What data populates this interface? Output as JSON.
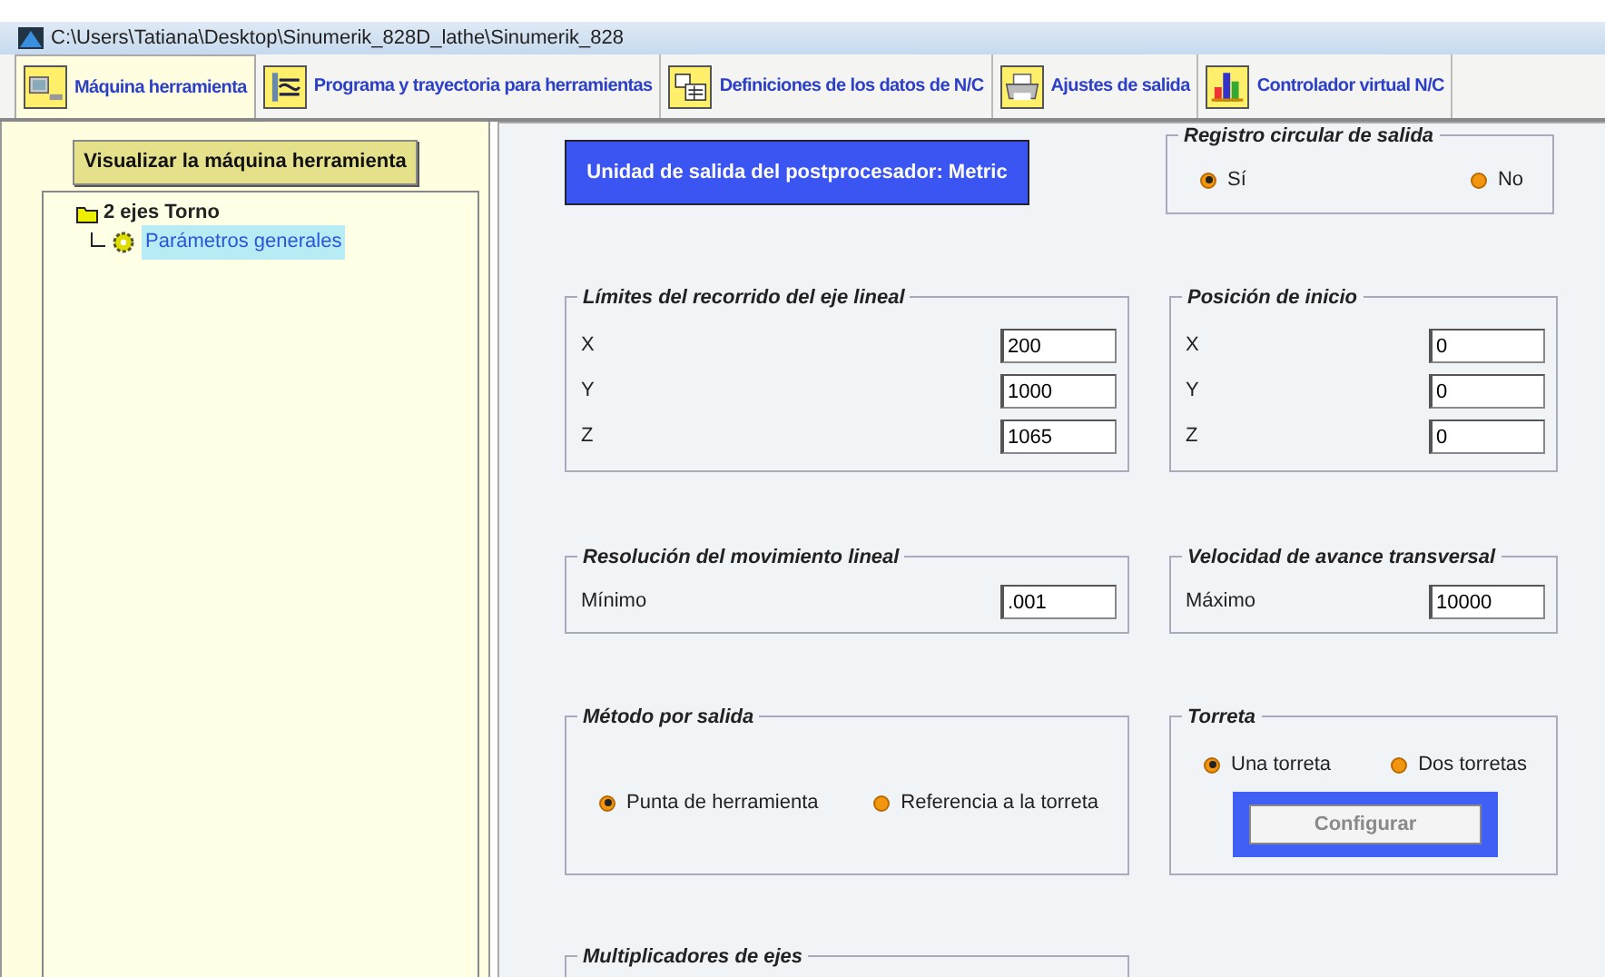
{
  "window": {
    "title": "C:\\Users\\Tatiana\\Desktop\\Sinumerik_828D_lathe\\Sinumerik_828"
  },
  "tabs": [
    {
      "label": "Máquina herramienta",
      "selected": true,
      "kind": "machine"
    },
    {
      "label": "Programa y trayectoria para herramientas",
      "selected": false,
      "kind": "program"
    },
    {
      "label": "Definiciones de los datos de N/C",
      "selected": false,
      "kind": "table"
    },
    {
      "label": "Ajustes de salida",
      "selected": false,
      "kind": "printer"
    },
    {
      "label": "Controlador virtual N/C",
      "selected": false,
      "kind": "chart"
    }
  ],
  "sidebar": {
    "button": "Visualizar la máquina herramienta",
    "tree": [
      {
        "label": "2 ejes Torno",
        "children": [
          {
            "label": "Parámetros generales",
            "selected": true
          }
        ]
      }
    ]
  },
  "banner": "Unidad de salida del postprocesador: Metric",
  "rows": [
    [
      {
        "title": "Registro circular de salida",
        "kind": "radios",
        "options": [
          {
            "label": "Sí",
            "selected": true
          },
          {
            "label": "No",
            "selected": false
          }
        ]
      }
    ],
    [
      {
        "title": "Límites del recorrido del eje lineal",
        "kind": "fields",
        "fields": [
          {
            "label": "X",
            "value": "200"
          },
          {
            "label": "Y",
            "value": "1000"
          },
          {
            "label": "Z",
            "value": "1065"
          }
        ]
      },
      {
        "title": "Posición de inicio",
        "kind": "fields",
        "fields": [
          {
            "label": "X",
            "value": "0"
          },
          {
            "label": "Y",
            "value": "0"
          },
          {
            "label": "Z",
            "value": "0"
          }
        ]
      }
    ],
    [
      {
        "title": "Resolución del movimiento lineal",
        "kind": "fields",
        "fields": [
          {
            "label": "Mínimo",
            "value": ".001"
          }
        ]
      },
      {
        "title": "Velocidad de avance transversal",
        "kind": "fields",
        "fields": [
          {
            "label": "Máximo",
            "value": "10000"
          }
        ]
      }
    ],
    [
      {
        "title": "Método por salida",
        "kind": "radios",
        "options": [
          {
            "label": "Punta de herramienta",
            "selected": true
          },
          {
            "label": "Referencia a la torreta",
            "selected": false
          }
        ]
      },
      {
        "title": "Torreta",
        "kind": "radios",
        "options": [
          {
            "label": "Una torreta",
            "selected": true
          },
          {
            "label": "Dos torretas",
            "selected": false
          }
        ],
        "button": {
          "label": "Configurar",
          "disabled": true
        }
      }
    ],
    [
      {
        "title": "Multiplicadores de ejes",
        "kind": "empty"
      }
    ]
  ]
}
